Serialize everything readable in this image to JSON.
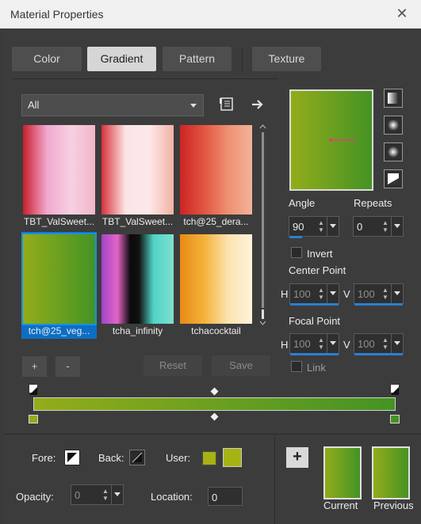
{
  "window": {
    "title": "Material Properties",
    "close_glyph": "✕"
  },
  "tabs": [
    {
      "label": "Color",
      "active": false
    },
    {
      "label": "Gradient",
      "active": true
    },
    {
      "label": "Pattern",
      "active": false
    },
    {
      "label": "Texture",
      "active": false
    }
  ],
  "category": {
    "selected": "All"
  },
  "gradients": [
    {
      "name": "TBT_ValSweet...",
      "colors": [
        "#c81f2a",
        "#f2a8cf",
        "#f6d0e2",
        "#f1b7c7"
      ]
    },
    {
      "name": "TBT_ValSweet...",
      "colors": [
        "#d8323a",
        "#fbe4e6",
        "#fde8e8",
        "#f1b1a5"
      ]
    },
    {
      "name": "tch@25_dera...",
      "colors": [
        "#cd2326",
        "#e2553f",
        "#ef9072",
        "#f2b39a"
      ]
    },
    {
      "name": "tch@25_veg...",
      "colors": [
        "#93ac1a",
        "#449325"
      ],
      "selected": true
    },
    {
      "name": "tcha_infinity",
      "colors": [
        "#a044c8",
        "#e265c8",
        "#0a0a0a",
        "#111111",
        "#4fd4c6",
        "#7fe0cf"
      ]
    },
    {
      "name": "tchacocktail",
      "colors": [
        "#e88a16",
        "#f4b23a",
        "#fbe3b0",
        "#fff3dc"
      ]
    }
  ],
  "buttons": {
    "add": "+",
    "remove": "-",
    "reset": "Reset",
    "save": "Save"
  },
  "angle": {
    "label": "Angle",
    "value": "90",
    "level": 0.25
  },
  "repeats": {
    "label": "Repeats",
    "value": "0"
  },
  "invert": {
    "label": "Invert"
  },
  "center_point": {
    "label": "Center Point",
    "h_label": "H",
    "v_label": "V",
    "h": "100",
    "v": "100"
  },
  "focal_point": {
    "label": "Focal Point",
    "h_label": "H",
    "v_label": "V",
    "h": "100",
    "v": "100"
  },
  "link": {
    "label": "Link"
  },
  "editor": {
    "stop_start_color": "#93ac1a",
    "stop_end_color": "#449325"
  },
  "fore": {
    "label": "Fore:"
  },
  "back": {
    "label": "Back:"
  },
  "user": {
    "label": "User:",
    "color": "#a7b214"
  },
  "opacity": {
    "label": "Opacity:",
    "value": "0"
  },
  "location": {
    "label": "Location:",
    "value": "0"
  },
  "current": {
    "label": "Current"
  },
  "previous": {
    "label": "Previous"
  },
  "add_plus": "+",
  "colors": {
    "accent": "#0c6fc4",
    "gradient_start": "#93ac1a",
    "gradient_end": "#449325"
  }
}
